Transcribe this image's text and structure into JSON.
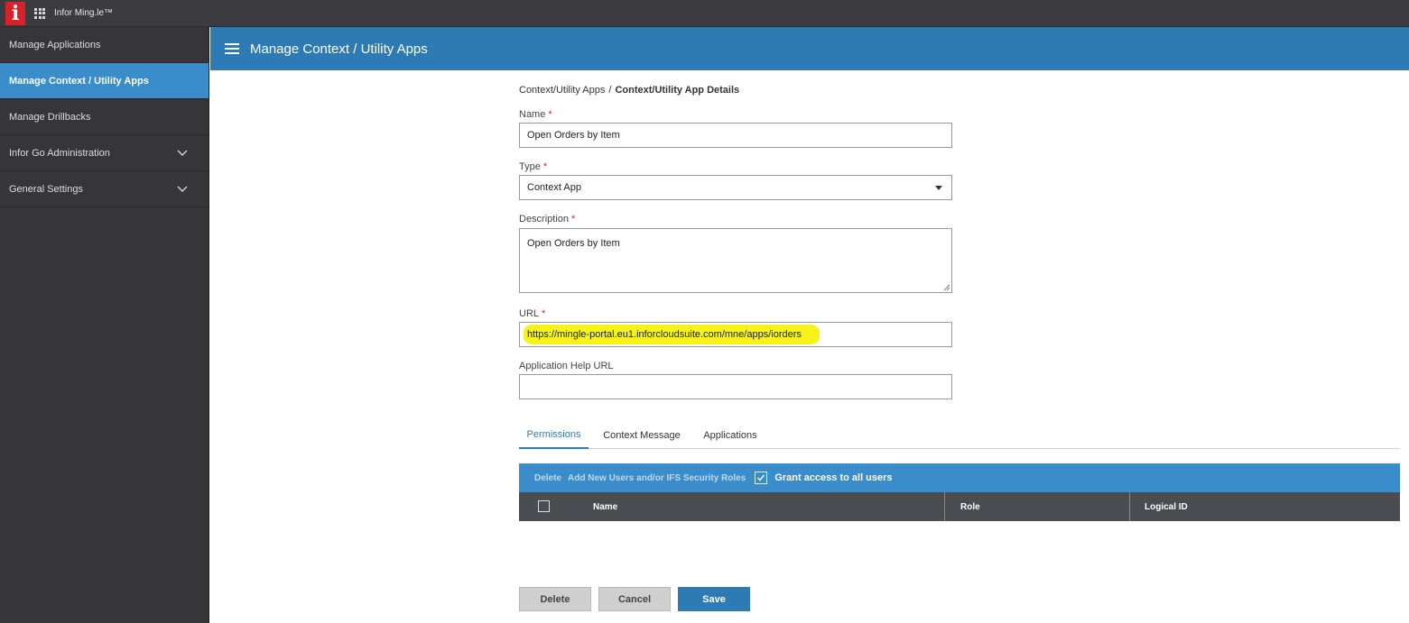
{
  "topbar": {
    "logo_letter": "i",
    "app_title": "Infor Ming.le™"
  },
  "sidebar": {
    "items": [
      {
        "label": "Manage Applications"
      },
      {
        "label": "Manage Context / Utility Apps"
      },
      {
        "label": "Manage Drillbacks"
      },
      {
        "label": "Infor Go Administration"
      },
      {
        "label": "General Settings"
      }
    ]
  },
  "header": {
    "title": "Manage Context / Utility Apps"
  },
  "breadcrumb": {
    "parent": "Context/Utility Apps",
    "separator": "/",
    "current": "Context/Utility App Details"
  },
  "form": {
    "name": {
      "label": "Name",
      "required": "*",
      "value": "Open Orders by Item"
    },
    "type": {
      "label": "Type",
      "required": "*",
      "value": "Context App"
    },
    "description": {
      "label": "Description",
      "required": "*",
      "value": "Open Orders by Item"
    },
    "url": {
      "label": "URL",
      "required": "*",
      "value": "https://mingle-portal.eu1.inforcloudsuite.com/mne/apps/iorders"
    },
    "help_url": {
      "label": "Application Help URL",
      "value": ""
    }
  },
  "tabs": [
    {
      "label": "Permissions"
    },
    {
      "label": "Context Message"
    },
    {
      "label": "Applications"
    }
  ],
  "permissions": {
    "delete_label": "Delete",
    "add_label": "Add New Users and/or IFS Security Roles",
    "grant_label": "Grant access to all users",
    "columns": [
      "Name",
      "Role",
      "Logical ID"
    ]
  },
  "buttons": {
    "delete": "Delete",
    "cancel": "Cancel",
    "save": "Save"
  },
  "colors": {
    "header_blue": "#2e7ab4",
    "active_blue": "#3a8ccb",
    "sidebar_dark": "#36363a",
    "required_red": "#d8212a",
    "highlight_yellow": "#f7f31a"
  }
}
